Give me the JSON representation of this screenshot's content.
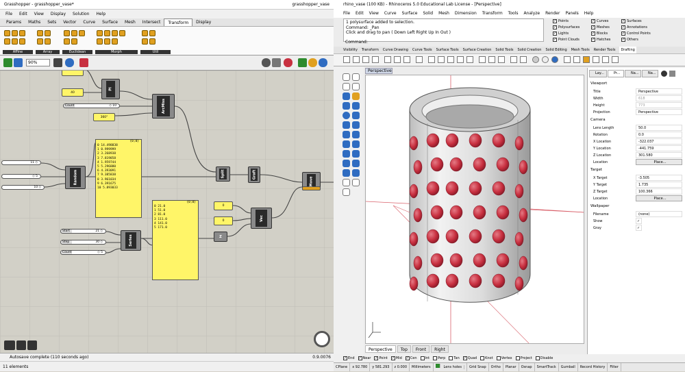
{
  "gh": {
    "title": "Grasshopper - grasshopper_vase*",
    "doc_name": "grasshopper_vase",
    "menu": [
      "File",
      "Edit",
      "View",
      "Display",
      "Solution",
      "Help"
    ],
    "tabs": [
      "Params",
      "Maths",
      "Sets",
      "Vector",
      "Curve",
      "Surface",
      "Mesh",
      "Intersect",
      "Transform",
      "Display"
    ],
    "ribbon_groups": [
      "Affine",
      "Array",
      "Euclidean",
      "Morph",
      "Util"
    ],
    "zoom": "90%",
    "status": "Autosave complete (110 seconds ago)",
    "version": "0.9.0076",
    "bottom": "11 elements",
    "sliders": [
      {
        "label": "",
        "value": "11 ◇"
      },
      {
        "label": "",
        "value": "◇ 5"
      },
      {
        "label": "",
        "value": "10 ◇"
      },
      {
        "label": "Count",
        "value": "◇ 10"
      },
      {
        "label": "Start",
        "value": "21 ◇"
      },
      {
        "label": "Step",
        "value": "30 ◇"
      },
      {
        "label": "Count",
        "value": "◇ 5"
      }
    ],
    "params": [
      "0",
      "40",
      "360°",
      "0",
      "0"
    ],
    "components": [
      "Pl",
      "ArcMiss",
      "Random",
      "Split",
      "Graft",
      "Move",
      "Vec",
      "Series",
      "Z",
      "Deg"
    ],
    "panel1": {
      "header": "{0;0}",
      "rows": [
        "0 14.498838",
        "1 0.999999",
        "2 3.268938",
        "3 7.819858",
        "4 1.959744",
        "5 5.296880",
        "6 4.393091",
        "7 9.385838",
        "8 3.961034",
        "9 6.391675",
        "10 5.893033"
      ]
    },
    "panel2": {
      "header": "{0;0}",
      "rows": [
        "0 21.0",
        "1 51.0",
        "2 81.0",
        "3 111.0",
        "4 141.0",
        "5 171.0"
      ]
    }
  },
  "rh": {
    "title": "rhino_vase (100 KB) - Rhinoceros 5.0 Educational Lab License - [Perspective]",
    "menu": [
      "File",
      "Edit",
      "View",
      "Curve",
      "Surface",
      "Solid",
      "Mesh",
      "Dimension",
      "Transform",
      "Tools",
      "Analyze",
      "Render",
      "Panels",
      "Help"
    ],
    "history": [
      "1 polysurface added to selection.",
      "Command: _Pan",
      "Click and drag to pan ( Down Left Right Up In Out )"
    ],
    "command_label": "Command:",
    "layers": [
      {
        "name": "Points",
        "on": true
      },
      {
        "name": "Curves",
        "on": true
      },
      {
        "name": "Surfaces",
        "on": true
      },
      {
        "name": "Polysurfaces",
        "on": true
      },
      {
        "name": "Meshes",
        "on": true
      },
      {
        "name": "Annotations",
        "on": true
      },
      {
        "name": "Lights",
        "on": true
      },
      {
        "name": "Blocks",
        "on": true
      },
      {
        "name": "Control Points",
        "on": true
      },
      {
        "name": "Point Clouds",
        "on": true
      },
      {
        "name": "Hatches",
        "on": true
      },
      {
        "name": "Others",
        "on": true
      }
    ],
    "toolbar_tabs": [
      "Visibility",
      "Transform",
      "Curve Drawing",
      "Curve Tools",
      "Surface Tools",
      "Surface Creation",
      "Solid Tools",
      "Solid Creation",
      "Solid Editing",
      "Mesh Tools",
      "Render Tools",
      "Drafting"
    ],
    "viewport_label": "Perspective",
    "viewport_tabs": [
      "Perspective",
      "Top",
      "Front",
      "Right"
    ],
    "props": {
      "tabs": [
        "Lay...",
        "Pr...",
        "Na...",
        "Na..."
      ],
      "section_viewport": "Viewport",
      "viewport_rows": [
        {
          "k": "Title",
          "v": "Perspective"
        },
        {
          "k": "Width",
          "v": "618"
        },
        {
          "k": "Height",
          "v": "773"
        },
        {
          "k": "Projection",
          "v": "Perspective"
        }
      ],
      "section_camera": "Camera",
      "camera_rows": [
        {
          "k": "Lens Length",
          "v": "50.0"
        },
        {
          "k": "Rotation",
          "v": "0.0"
        },
        {
          "k": "X Location",
          "v": "-322.037"
        },
        {
          "k": "Y Location",
          "v": "-441.759"
        },
        {
          "k": "Z Location",
          "v": "301.580"
        },
        {
          "k": "Location",
          "v": "Place..."
        }
      ],
      "section_target": "Target",
      "target_rows": [
        {
          "k": "X Target",
          "v": "-3.505"
        },
        {
          "k": "Y Target",
          "v": "1.735"
        },
        {
          "k": "Z Target",
          "v": "100.366"
        },
        {
          "k": "Location",
          "v": "Place..."
        }
      ],
      "section_wallpaper": "Wallpaper",
      "wallpaper_rows": [
        {
          "k": "Filename",
          "v": "(none)"
        },
        {
          "k": "Show",
          "v": "✓"
        },
        {
          "k": "Gray",
          "v": "✓"
        }
      ]
    },
    "osnaps": [
      "End",
      "Near",
      "Point",
      "Mid",
      "Cen",
      "Int",
      "Perp",
      "Tan",
      "Quad",
      "Knot",
      "Vertex",
      "Project",
      "Disable"
    ],
    "osnaps_checked": [
      true,
      true,
      true,
      true,
      true,
      false,
      false,
      false,
      true,
      false,
      false,
      false,
      false
    ],
    "status": [
      "CPlane",
      "x 92.780",
      "y 581.293",
      "z 0.000",
      "Millimeters",
      "Lens holes",
      "Grid Snap",
      "Ortho",
      "Planar",
      "Osnap",
      "SmartTrack",
      "Gumball",
      "Record History",
      "Filter"
    ],
    "status_layer_color": "#2e8b2e"
  },
  "colors": {
    "sphere": "#c83040",
    "panel": "#fff568",
    "accent": "#2f6cc1"
  }
}
